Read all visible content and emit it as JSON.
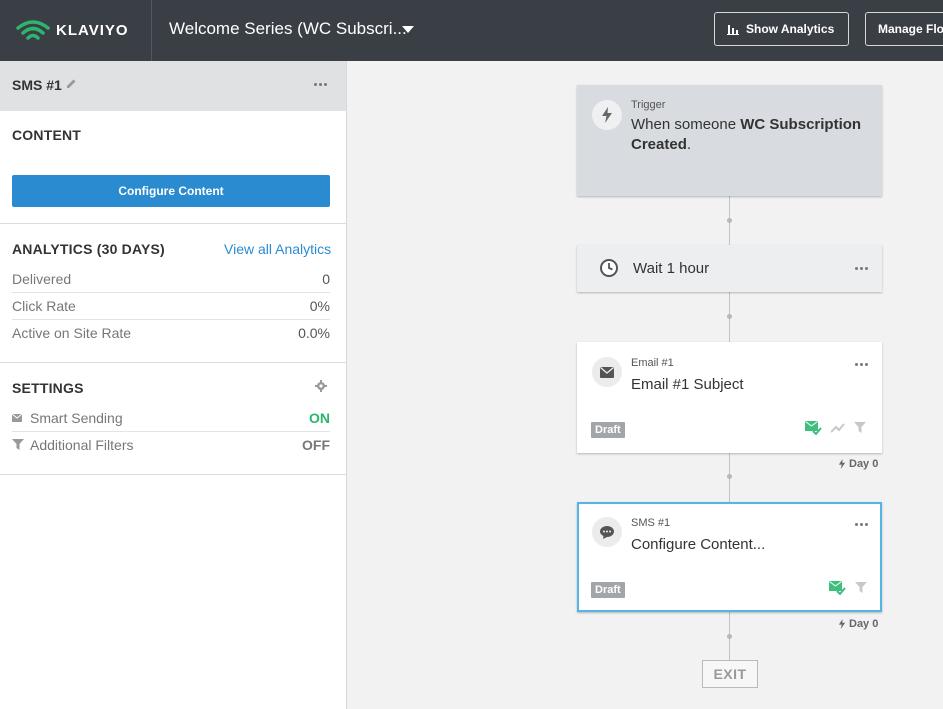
{
  "topbar": {
    "logo_text": "KLAVIYO",
    "flow_name": "Welcome Series (WC Subscri...",
    "show_analytics_label": "Show Analytics",
    "manage_flow_label": "Manage Flo"
  },
  "sidebar": {
    "title": "SMS #1",
    "content_section": {
      "title": "CONTENT",
      "configure_button": "Configure Content"
    },
    "analytics_section": {
      "title": "ANALYTICS (30 DAYS)",
      "view_all_link": "View all Analytics",
      "rows": [
        {
          "label": "Delivered",
          "value": "0"
        },
        {
          "label": "Click Rate",
          "value": "0%"
        },
        {
          "label": "Active on Site Rate",
          "value": "0.0%"
        }
      ]
    },
    "settings_section": {
      "title": "SETTINGS",
      "rows": [
        {
          "label": "Smart Sending",
          "value": "ON"
        },
        {
          "label": "Additional Filters",
          "value": "OFF"
        }
      ]
    }
  },
  "flow": {
    "trigger": {
      "label": "Trigger",
      "text_prefix": "When someone ",
      "text_bold": "WC Subscription Created",
      "text_suffix": "."
    },
    "wait": {
      "label": "Wait 1 hour"
    },
    "email": {
      "label": "Email #1",
      "subject": "Email #1 Subject",
      "status": "Draft",
      "day_label": "Day 0"
    },
    "sms": {
      "label": "SMS #1",
      "content": "Configure Content...",
      "status": "Draft",
      "day_label": "Day 0"
    },
    "exit_label": "EXIT"
  },
  "colors": {
    "topbar": "#3a3f45",
    "primary_button": "#2a8bd0",
    "on_status": "#2bb56d",
    "selected_border": "#56b5e6"
  }
}
